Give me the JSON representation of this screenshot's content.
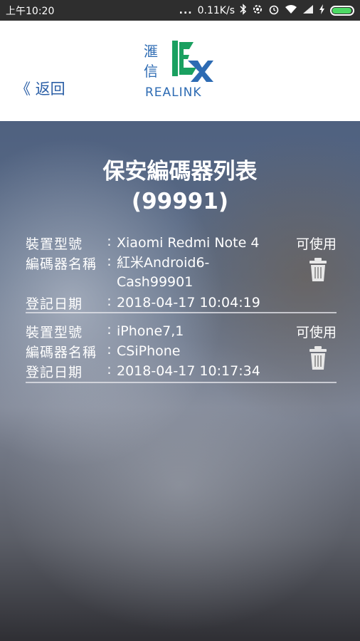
{
  "status_bar": {
    "time": "上午10:20",
    "dots": "...",
    "speed": "0.11K/s",
    "icons": [
      "bluetooth-icon",
      "settings-icon",
      "alarm-icon",
      "wifi-icon",
      "signal-icon",
      "charging-icon",
      "battery-icon"
    ],
    "battery_level": 0.95,
    "battery_color": "#4cd964"
  },
  "header": {
    "back_label": "《 返回",
    "logo_chars": [
      "滙",
      "信"
    ],
    "logo_text": "REALINK",
    "logo_colors": {
      "green": "#1aa060",
      "blue": "#2d6bb3"
    }
  },
  "page": {
    "title_line1": "保安編碼器列表",
    "title_line2": "(99991)"
  },
  "labels": {
    "model": "裝置型號",
    "name": "編碼器名稱",
    "date": "登記日期",
    "colon": ":"
  },
  "devices": [
    {
      "model": "Xiaomi Redmi Note 4",
      "name_line1": "紅米Android6-",
      "name_line2": "Cash99901",
      "date": "2018-04-17 10:04:19",
      "status": "可使用"
    },
    {
      "model": "iPhone7,1",
      "name_line1": "CSiPhone",
      "name_line2": "",
      "date": "2018-04-17 10:17:34",
      "status": "可使用"
    }
  ]
}
